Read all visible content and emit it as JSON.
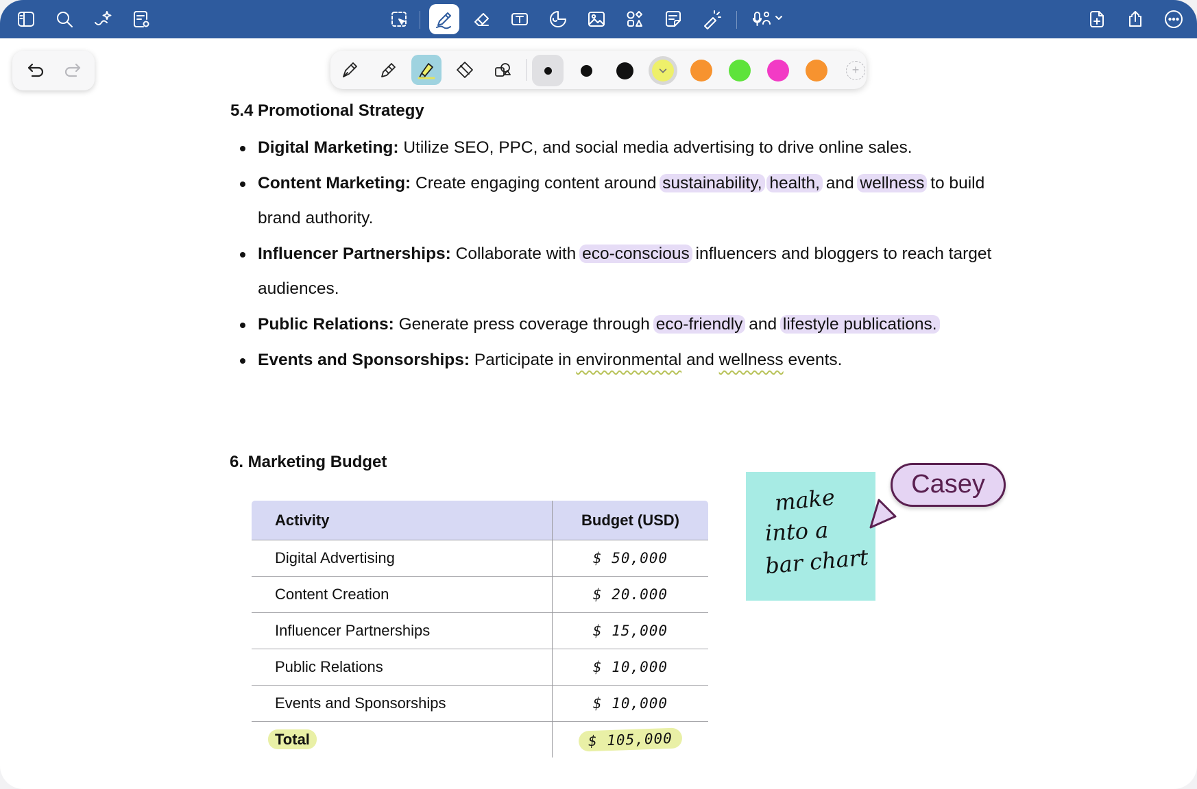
{
  "colors": {
    "topbar": "#2e5b9e",
    "highlight_purple": "#e6dcf6",
    "highlight_yellow": "#e9f0a6",
    "table_header": "#d7d9f4",
    "sticky_note": "#a7ebe4",
    "name_tag": "#e5d4f3",
    "name_tag_border": "#5a2050"
  },
  "toolbar": {
    "left_icons": [
      "sidebar-icon",
      "search-icon",
      "sparkle-assistant-icon",
      "note-settings-icon"
    ],
    "center_icons": [
      "lasso-select-icon",
      "pen-icon",
      "eraser-icon",
      "text-box-icon",
      "shapes-icon",
      "image-icon",
      "elements-icon",
      "sticky-note-icon",
      "laser-pointer-icon",
      "audio-record-icon"
    ],
    "right_icons": [
      "add-page-icon",
      "share-icon",
      "more-icon"
    ],
    "active_tool": "pen-icon"
  },
  "palette": {
    "tools": [
      "fountain-pen-icon",
      "ball-pen-icon",
      "highlighter-icon",
      "eraser-tip-icon",
      "shape-tool-icon"
    ],
    "active_tool": "highlighter-icon",
    "swatches": [
      {
        "color": "#111111",
        "selected": true
      },
      {
        "color": "#111111",
        "selected": false
      },
      {
        "color": "#111111",
        "selected": false
      },
      {
        "color": "#eef06a",
        "selected": false,
        "checked": true
      },
      {
        "color": "#f7932f",
        "selected": false
      },
      {
        "color": "#5ee33b",
        "selected": false
      },
      {
        "color": "#f23bc5",
        "selected": false
      },
      {
        "color": "#f7932f",
        "selected": false
      }
    ],
    "add_label": "+"
  },
  "section54": {
    "heading": "5.4 Promotional Strategy",
    "items": [
      {
        "label": "Digital Marketing:",
        "text": " Utilize SEO, PPC, and social media advertising to drive online sales."
      },
      {
        "label": "Content Marketing:",
        "text_a": " Create engaging content around ",
        "hl1": "sustainability,",
        "hl2": "health,",
        "mid": " and ",
        "hl3": "wellness",
        "text_b": " to build brand authority."
      },
      {
        "label": "Influencer Partnerships:",
        "text_a": " Collaborate with ",
        "hl1": "eco-conscious",
        "text_b": " influencers and bloggers to reach target audiences."
      },
      {
        "label": "Public Relations:",
        "text_a": " Generate press coverage through ",
        "hl1": "eco-friendly",
        "mid": " and ",
        "hl2": "lifestyle publications."
      },
      {
        "label": "Events and Sponsorships:",
        "text_a": " Participate in ",
        "u1": "environmental",
        "mid": " and ",
        "u2": "wellness",
        "text_b": " events."
      }
    ]
  },
  "section6": {
    "heading": "6. Marketing Budget",
    "table": {
      "headers": [
        "Activity",
        "Budget (USD)"
      ],
      "rows": [
        [
          "Digital Advertising",
          "$ 50,000"
        ],
        [
          "Content Creation",
          "$ 20.000"
        ],
        [
          "Influencer Partnerships",
          "$ 15,000"
        ],
        [
          "Public Relations",
          "$ 10,000"
        ],
        [
          "Events and Sponsorships",
          "$ 10,000"
        ]
      ],
      "total": [
        "Total",
        "$ 105,000"
      ]
    }
  },
  "sticky_note": {
    "lines": [
      "make",
      "into a",
      "bar chart"
    ],
    "author": "Casey"
  }
}
